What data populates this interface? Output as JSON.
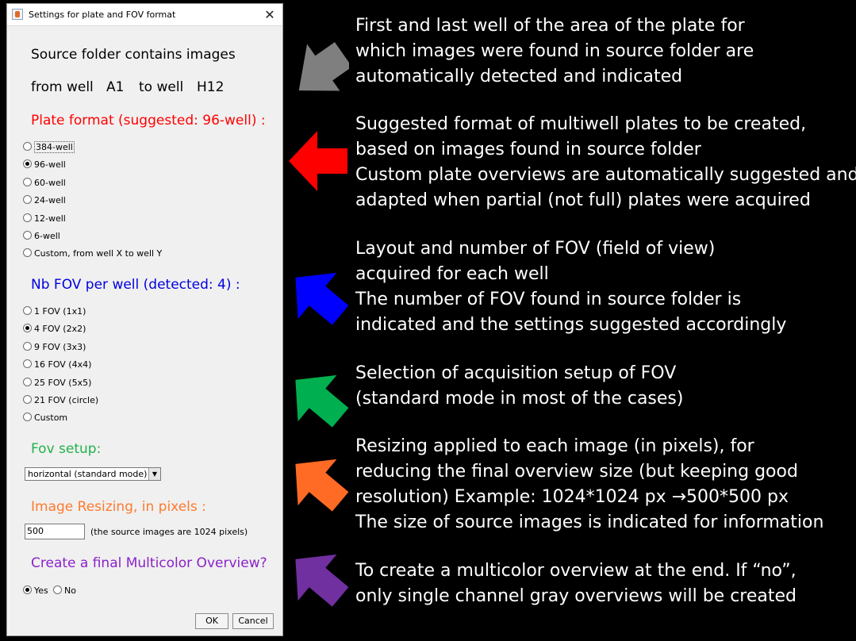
{
  "dialog": {
    "title": "Settings for plate and FOV format",
    "close_glyph": "✕",
    "source_line1": "Source folder contains images",
    "from_label": "from well",
    "from_value": "A1",
    "to_label": "to well",
    "to_value": "H12",
    "plate_header": "Plate format (suggested: 96-well) :",
    "plate_options": [
      "384-well",
      "96-well",
      "60-well",
      "24-well",
      "12-well",
      "6-well",
      "Custom, from well X to well Y"
    ],
    "plate_selected": "96-well",
    "fov_header": "Nb FOV per well (detected: 4) :",
    "fov_options": [
      "1 FOV (1x1)",
      "4 FOV (2x2)",
      "9 FOV (3x3)",
      "16 FOV (4x4)",
      "25 FOV (5x5)",
      "21 FOV (circle)",
      "Custom"
    ],
    "fov_selected": "4 FOV (2x2)",
    "fov_setup_header": "Fov setup:",
    "fov_setup_value": "horizontal (standard mode)",
    "resize_header": "Image Resizing, in pixels :",
    "resize_value": "500",
    "resize_note": "(the source images are 1024 pixels)",
    "multicolor_header": "Create a final Multicolor Overview?",
    "yes_label": "Yes",
    "no_label": "No",
    "multicolor_selected": "Yes",
    "ok_label": "OK",
    "cancel_label": "Cancel"
  },
  "colors": {
    "plate_header": "#ff0000",
    "fov_header": "#0000e0",
    "fov_setup_header": "#22b14c",
    "resize_header": "#ff7a2e",
    "multicolor_header": "#8b22c9",
    "arrow_gray": "#7f7f7f",
    "arrow_red": "#ff0000",
    "arrow_blue": "#0000ff",
    "arrow_green": "#00b050",
    "arrow_orange": "#ff6a24",
    "arrow_purple": "#7030a0"
  },
  "annotations": [
    {
      "icon": "arrow-gray-icon",
      "lines": [
        "First and last well of the area of the plate for",
        "which images were found in source folder are",
        "automatically detected and indicated"
      ]
    },
    {
      "icon": "arrow-red-icon",
      "lines": [
        "Suggested format of multiwell plates to be created,",
        "based on images found in source folder",
        "Custom plate overviews are automatically suggested and",
        "adapted when partial (not full) plates were acquired"
      ]
    },
    {
      "icon": "arrow-blue-icon",
      "lines": [
        "Layout and number of FOV (field of view)",
        "acquired for each well",
        "The number of FOV found in source folder is",
        "indicated and the settings suggested accordingly"
      ]
    },
    {
      "icon": "arrow-green-icon",
      "lines": [
        "Selection of acquisition setup of FOV",
        "(standard mode in most of the cases)"
      ]
    },
    {
      "icon": "arrow-orange-icon",
      "lines": [
        "Resizing applied to each image (in pixels), for",
        "reducing the final overview size (but keeping good",
        "resolution) Example: 1024*1024 px →500*500 px",
        "The size of source images is indicated for information"
      ]
    },
    {
      "icon": "arrow-purple-icon",
      "lines": [
        "To create a multicolor overview at the end. If “no”,",
        "only single channel gray overviews will be created"
      ]
    }
  ]
}
